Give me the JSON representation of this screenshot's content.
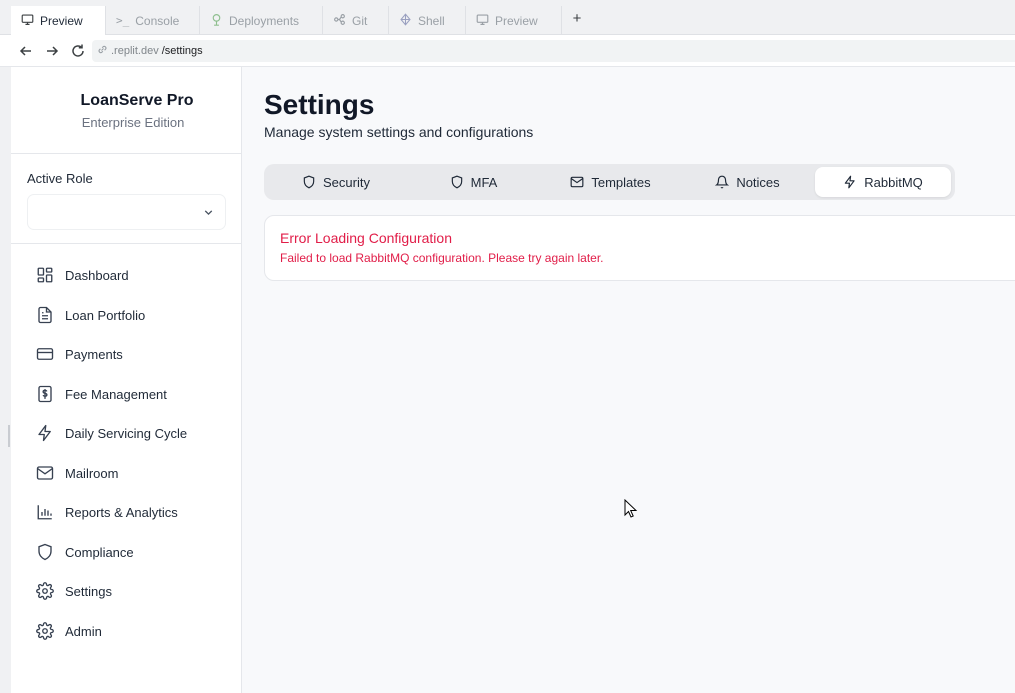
{
  "browser": {
    "tabs": [
      {
        "label": "Preview",
        "icon": "monitor-icon",
        "active": true
      },
      {
        "label": "Console",
        "icon": "terminal-icon",
        "active": false
      },
      {
        "label": "Deployments",
        "icon": "deploy-icon",
        "active": false
      },
      {
        "label": "Git",
        "icon": "git-icon",
        "active": false
      },
      {
        "label": "Shell",
        "icon": "shell-icon",
        "active": false
      },
      {
        "label": "Preview",
        "icon": "monitor-icon",
        "active": false
      }
    ],
    "new_tab_label": "+",
    "url_host": ".replit.dev",
    "url_path": "/settings"
  },
  "sidebar": {
    "brand_name": "LoanServe Pro",
    "brand_subtitle": "Enterprise Edition",
    "role_label": "Active Role",
    "role_value": "",
    "items": [
      {
        "label": "Dashboard",
        "icon": "dashboard-icon"
      },
      {
        "label": "Loan Portfolio",
        "icon": "file-text-icon"
      },
      {
        "label": "Payments",
        "icon": "credit-card-icon"
      },
      {
        "label": "Fee Management",
        "icon": "dollar-receipt-icon"
      },
      {
        "label": "Daily Servicing Cycle",
        "icon": "lightning-icon"
      },
      {
        "label": "Mailroom",
        "icon": "mail-icon"
      },
      {
        "label": "Reports & Analytics",
        "icon": "bar-chart-icon"
      },
      {
        "label": "Compliance",
        "icon": "shield-icon"
      },
      {
        "label": "Settings",
        "icon": "gear-icon"
      },
      {
        "label": "Admin",
        "icon": "gear-icon"
      }
    ]
  },
  "main": {
    "title": "Settings",
    "subtitle": "Manage system settings and configurations",
    "tabs": [
      {
        "label": "Security",
        "icon": "shield-icon",
        "active": false
      },
      {
        "label": "MFA",
        "icon": "shield-icon",
        "active": false
      },
      {
        "label": "Templates",
        "icon": "mail-icon",
        "active": false
      },
      {
        "label": "Notices",
        "icon": "bell-icon",
        "active": false
      },
      {
        "label": "RabbitMQ",
        "icon": "lightning-icon",
        "active": true
      }
    ],
    "error": {
      "title": "Error Loading Configuration",
      "message": "Failed to load RabbitMQ configuration. Please try again later."
    }
  },
  "colors": {
    "error": "#e11d48",
    "tab_track": "#e8e9ec",
    "main_bg": "#f8f9fb"
  }
}
